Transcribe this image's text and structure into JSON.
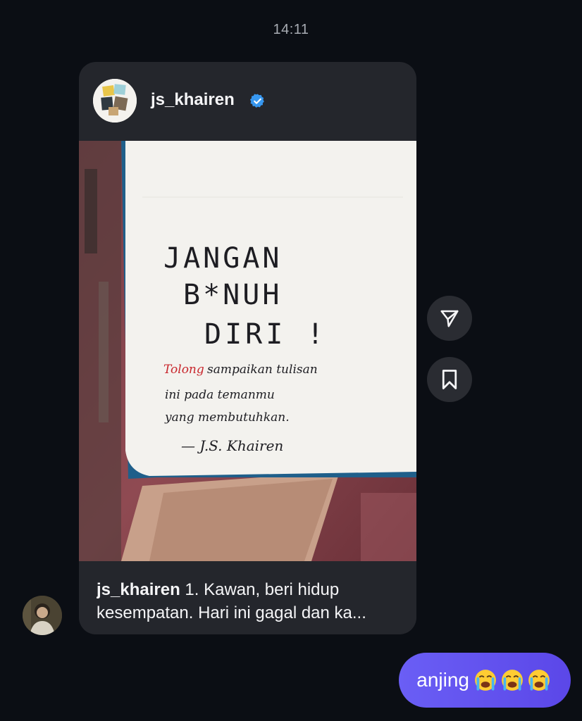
{
  "timestamp": "14:11",
  "post": {
    "username": "js_khairen",
    "verified": true,
    "image": {
      "handwriting_lines": [
        "JANGAN",
        "B*NUH",
        "DIRI !"
      ],
      "note_highlight": "Tolong",
      "note_lines": [
        "sampaikan tulisan",
        "ini pada temanmu",
        "yang membutuhkan."
      ],
      "signature": "— J.S. Khairen"
    },
    "caption_user": "js_khairen",
    "caption_line1": "1. Kawan, beri hidup",
    "caption_line2": "kesempatan. Hari ini gagal dan ka..."
  },
  "actions": {
    "share_icon": "send-icon",
    "save_icon": "bookmark-icon"
  },
  "outgoing_message": {
    "text": "anjing",
    "emoji": [
      "loudly-crying-face",
      "loudly-crying-face",
      "loudly-crying-face"
    ]
  },
  "colors": {
    "background": "#0b0e14",
    "card": "#24262c",
    "bubble": "#6a5ef5",
    "verified": "#3797f0"
  }
}
